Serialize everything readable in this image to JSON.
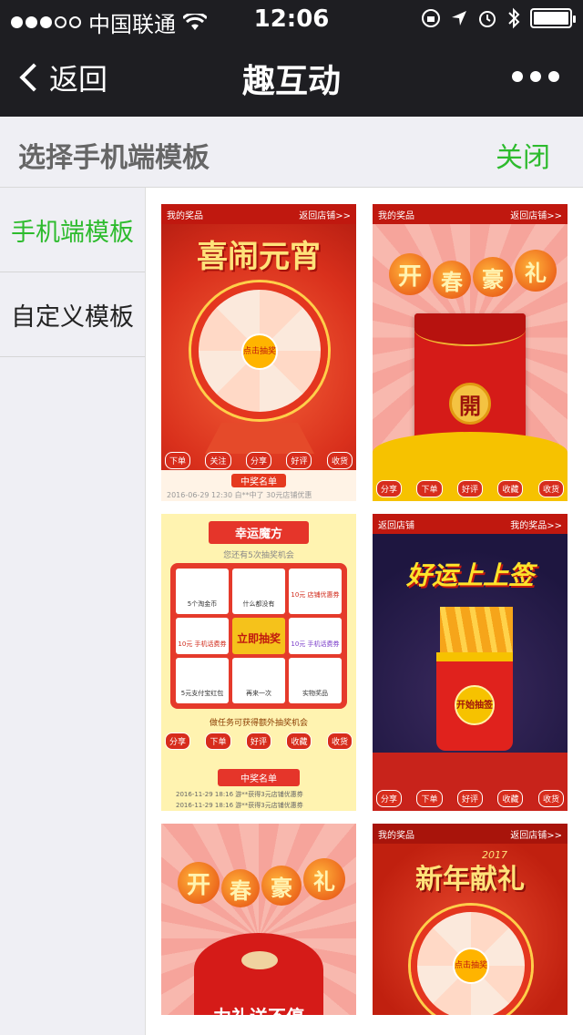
{
  "status_bar": {
    "carrier": "中国联通",
    "time": "12:06"
  },
  "nav": {
    "back_label": "返回",
    "title": "趣互动"
  },
  "header": {
    "title": "选择手机端模板",
    "close_label": "关闭"
  },
  "sidebar": {
    "items": [
      {
        "label": "手机端模板",
        "active": true
      },
      {
        "label": "自定义模板",
        "active": false
      }
    ]
  },
  "templates": [
    {
      "bar_left": "我的奖品",
      "bar_right": "返回店铺>>",
      "headline": "喜闹元宵",
      "center": "点击抽奖",
      "buttons": [
        "下单",
        "关注",
        "分享",
        "好评",
        "收货"
      ],
      "footer": "中奖名单",
      "ticker": "2016-06-29 12:30    白**中了 30元店铺优惠"
    },
    {
      "bar_left": "我的奖品",
      "bar_right": "返回店铺>>",
      "lanterns": [
        "开",
        "春",
        "豪",
        "礼"
      ],
      "center": "開",
      "buttons": [
        "分享",
        "下单",
        "好评",
        "收藏",
        "收货"
      ]
    },
    {
      "headline": "幸运魔方",
      "subtitle": "您还有5次抽奖机会",
      "cells": [
        "5个淘金币",
        "什么都没有",
        "10元 店铺优惠券",
        "10元 手机话费券",
        "立即抽奖",
        "10元 手机话费券",
        "5元支付宝红包",
        "再来一次",
        "实物奖品"
      ],
      "task": "做任务可获得额外抽奖机会",
      "buttons": [
        "分享",
        "下单",
        "好评",
        "收藏",
        "收货"
      ],
      "footer": "中奖名单",
      "rows": [
        "2016-11-29 18:16    游**获得3元店铺优惠券",
        "2016-11-29 18:16    游**获得3元店铺优惠券"
      ]
    },
    {
      "bar_left": "返回店铺",
      "bar_right": "我的奖品>>",
      "headline": "好运上上签",
      "center": "开始抽签",
      "buttons": [
        "分享",
        "下单",
        "好评",
        "收藏",
        "收货"
      ]
    },
    {
      "lanterns": [
        "开",
        "春",
        "豪",
        "礼"
      ],
      "caption": "力礼送不停"
    },
    {
      "bar_left": "我的奖品",
      "bar_right": "返回店铺>>",
      "headline": "新年献礼",
      "year": "2017",
      "center": "点击抽奖"
    }
  ],
  "colors": {
    "accent_green": "#2dbb2d",
    "nav_bg": "#1e1e22",
    "panel_bg": "#efeff4"
  }
}
